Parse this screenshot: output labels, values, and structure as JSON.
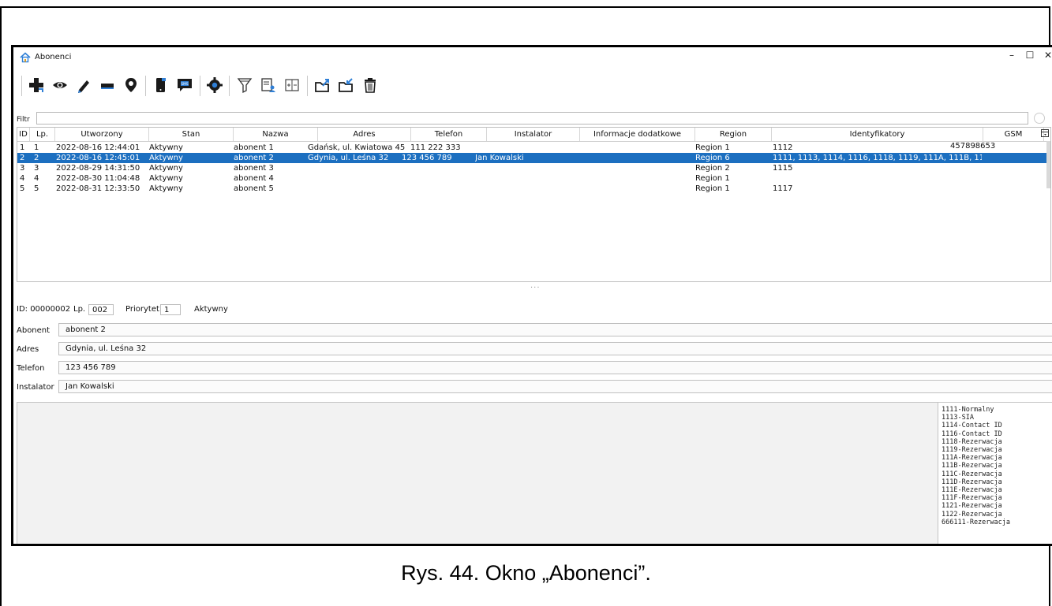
{
  "window": {
    "title": "Abonenci",
    "controls": {
      "minimize": "–",
      "maximize": "☐",
      "close": "✕"
    }
  },
  "toolbar": {
    "buttons": [
      {
        "icon": "add-icon"
      },
      {
        "icon": "eye-icon"
      },
      {
        "icon": "pencil-icon"
      },
      {
        "icon": "minus-icon"
      },
      {
        "icon": "location-pin-icon"
      },
      {
        "icon": "phone-icon"
      },
      {
        "icon": "sms-icon"
      },
      {
        "icon": "gear-icon"
      },
      {
        "icon": "filter-icon"
      },
      {
        "icon": "user-list-icon"
      },
      {
        "icon": "expand-columns-icon"
      },
      {
        "icon": "export-icon"
      },
      {
        "icon": "import-icon"
      },
      {
        "icon": "trash-icon"
      }
    ],
    "sms_text": "SMS"
  },
  "filter": {
    "label": "Filtr",
    "value": ""
  },
  "table": {
    "columns": [
      "ID",
      "Lp.",
      "Utworzony",
      "Stan",
      "Nazwa",
      "Adres",
      "Telefon",
      "Instalator",
      "Informacje dodatkowe",
      "Region",
      "Identyfikatory",
      "GSM"
    ],
    "rows": [
      {
        "id": "1",
        "lp": "1",
        "created": "2022-08-16 12:44:01",
        "state": "Aktywny",
        "name": "abonent 1",
        "address": "Gdańsk, ul. Kwiatowa 45",
        "phone": "111 222 333",
        "installer": "",
        "info": "",
        "region": "Region 1",
        "ids": "1112",
        "gsm": "457898653",
        "selected": false
      },
      {
        "id": "2",
        "lp": "2",
        "created": "2022-08-16 12:45:01",
        "state": "Aktywny",
        "name": "abonent 2",
        "address": "Gdynia, ul. Leśna 32",
        "phone": "123 456 789",
        "installer": "Jan Kowalski",
        "info": "",
        "region": "Region 6",
        "ids": "1111, 1113, 1114, 1116, 1118, 1119, 111A, 111B, 111...",
        "gsm": "",
        "selected": true
      },
      {
        "id": "3",
        "lp": "3",
        "created": "2022-08-29 14:31:50",
        "state": "Aktywny",
        "name": "abonent 3",
        "address": "",
        "phone": "",
        "installer": "",
        "info": "",
        "region": "Region 2",
        "ids": "1115",
        "gsm": "",
        "selected": false
      },
      {
        "id": "4",
        "lp": "4",
        "created": "2022-08-30 11:04:48",
        "state": "Aktywny",
        "name": "abonent 4",
        "address": "",
        "phone": "",
        "installer": "",
        "info": "",
        "region": "Region 1",
        "ids": "",
        "gsm": "",
        "selected": false
      },
      {
        "id": "5",
        "lp": "5",
        "created": "2022-08-31 12:33:50",
        "state": "Aktywny",
        "name": "abonent 5",
        "address": "",
        "phone": "",
        "installer": "",
        "info": "",
        "region": "Region 1",
        "ids": "1117",
        "gsm": "",
        "selected": false
      }
    ]
  },
  "splitter": "···",
  "details": {
    "id_text": "ID: 00000002",
    "lp_label": "Lp.",
    "lp_value": "002",
    "priority_label": "Priorytet",
    "priority_value": "1",
    "status": "Aktywny",
    "fields": [
      {
        "label": "Abonent",
        "value": "abonent 2"
      },
      {
        "label": "Adres",
        "value": "Gdynia, ul. Leśna 32"
      },
      {
        "label": "Telefon",
        "value": "123 456 789"
      },
      {
        "label": "Instalator",
        "value": "Jan Kowalski"
      }
    ],
    "identifiers": [
      "1111-Normalny",
      "1113-SIA",
      "1114-Contact ID",
      "1116-Contact ID",
      "1118-Rezerwacja",
      "1119-Rezerwacja",
      "111A-Rezerwacja",
      "111B-Rezerwacja",
      "111C-Rezerwacja",
      "111D-Rezerwacja",
      "111E-Rezerwacja",
      "111F-Rezerwacja",
      "1121-Rezerwacja",
      "1122-Rezerwacja",
      "666111-Rezerwacja"
    ]
  },
  "caption": "Rys. 44. Okno „Abonenci”.",
  "colors": {
    "selection": "#1c6fc0",
    "accent_blue": "#2f7fd6"
  }
}
